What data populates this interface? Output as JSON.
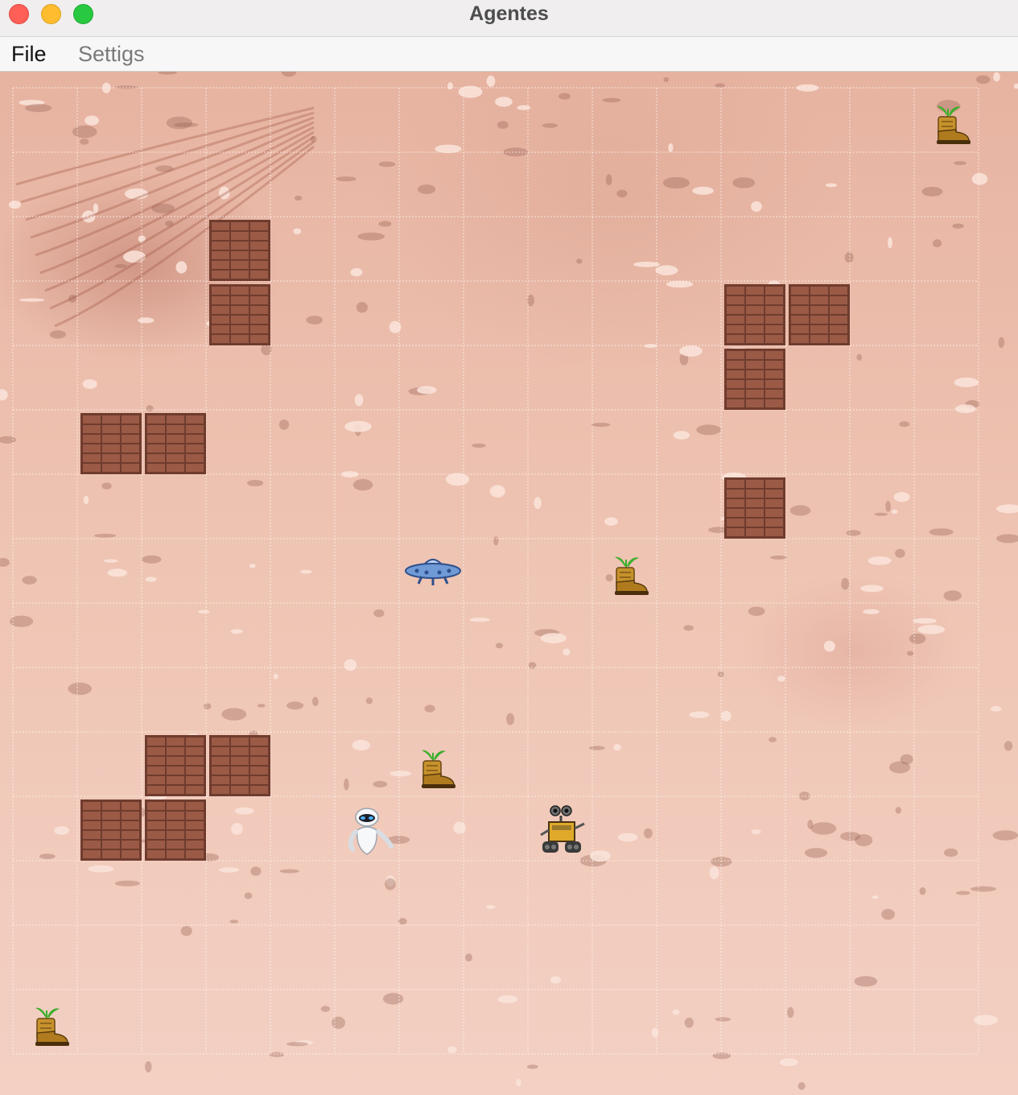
{
  "window": {
    "title": "Agentes",
    "buttons": [
      "close",
      "minimize",
      "maximize"
    ]
  },
  "menubar": {
    "items": [
      {
        "label": "File",
        "enabled": true
      },
      {
        "label": "Settigs",
        "enabled": false
      }
    ]
  },
  "board": {
    "columns": 15,
    "rows": 15,
    "background": "mars-terrain",
    "walls": [
      {
        "row": 2,
        "col": 3
      },
      {
        "row": 3,
        "col": 3
      },
      {
        "row": 3,
        "col": 11
      },
      {
        "row": 3,
        "col": 12
      },
      {
        "row": 4,
        "col": 11
      },
      {
        "row": 5,
        "col": 1
      },
      {
        "row": 5,
        "col": 2
      },
      {
        "row": 6,
        "col": 11
      },
      {
        "row": 10,
        "col": 2
      },
      {
        "row": 10,
        "col": 3
      },
      {
        "row": 11,
        "col": 1
      },
      {
        "row": 11,
        "col": 2
      }
    ],
    "samples": [
      {
        "row": 0,
        "col": 14,
        "icon": "boot-plant-icon"
      },
      {
        "row": 7,
        "col": 9,
        "icon": "boot-plant-icon"
      },
      {
        "row": 10,
        "col": 6,
        "icon": "boot-plant-icon"
      },
      {
        "row": 14,
        "col": 0,
        "icon": "boot-plant-icon"
      }
    ],
    "agents": [
      {
        "name": "ufo",
        "row": 7,
        "col": 6,
        "icon": "ufo-icon"
      },
      {
        "name": "eve",
        "row": 11,
        "col": 5,
        "icon": "eve-robot-icon"
      },
      {
        "name": "walle",
        "row": 11,
        "col": 8,
        "icon": "walle-robot-icon"
      }
    ]
  },
  "colors": {
    "terrain": "#efc5b4",
    "brick": "#9a5a46",
    "mortar": "#6f3c2e",
    "boot": "#c7922c",
    "plant": "#3fae2c",
    "ufo": "#6f9ad6"
  }
}
